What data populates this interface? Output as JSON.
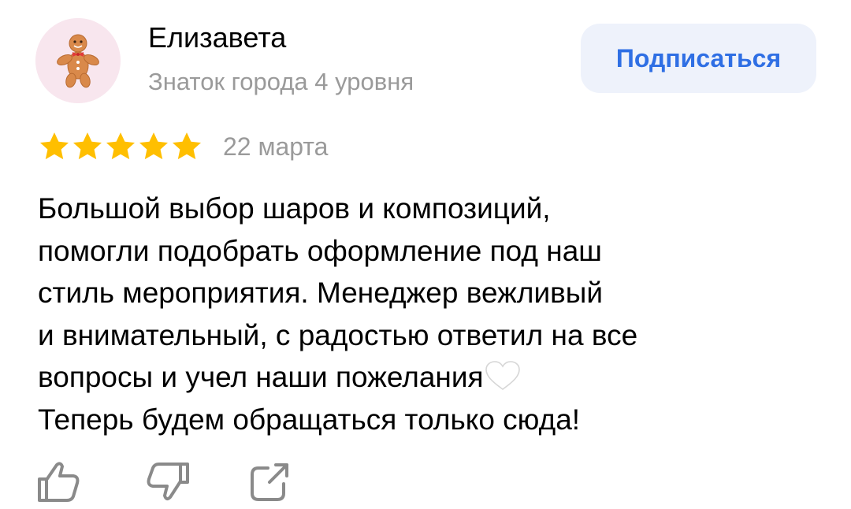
{
  "user": {
    "name": "Елизавета",
    "level": "Знаток города 4 уровня",
    "avatar_icon": "gingerbread-man-icon"
  },
  "subscribe": {
    "label": "Подписаться"
  },
  "review": {
    "rating": 5,
    "max_rating": 5,
    "date": "22 марта",
    "lines": [
      "Большой выбор шаров и композиций,",
      "помогли подобрать оформление под наш",
      "стиль мероприятия. Менеджер вежливый",
      "и внимательный, с радостью ответил на все",
      "вопросы и учел наши пожелания",
      "Теперь будем обращаться только сюда!"
    ],
    "emoji_after_line_5": "white-heart-icon"
  },
  "actions": {
    "like_icon": "thumbs-up-icon",
    "dislike_icon": "thumbs-down-icon",
    "share_icon": "share-icon"
  },
  "colors": {
    "accent": "#2f6fe4",
    "button_bg": "#eef2fb",
    "star": "#ffbf00",
    "muted_text": "#9a9a9a",
    "icon": "#8a8a8a"
  }
}
